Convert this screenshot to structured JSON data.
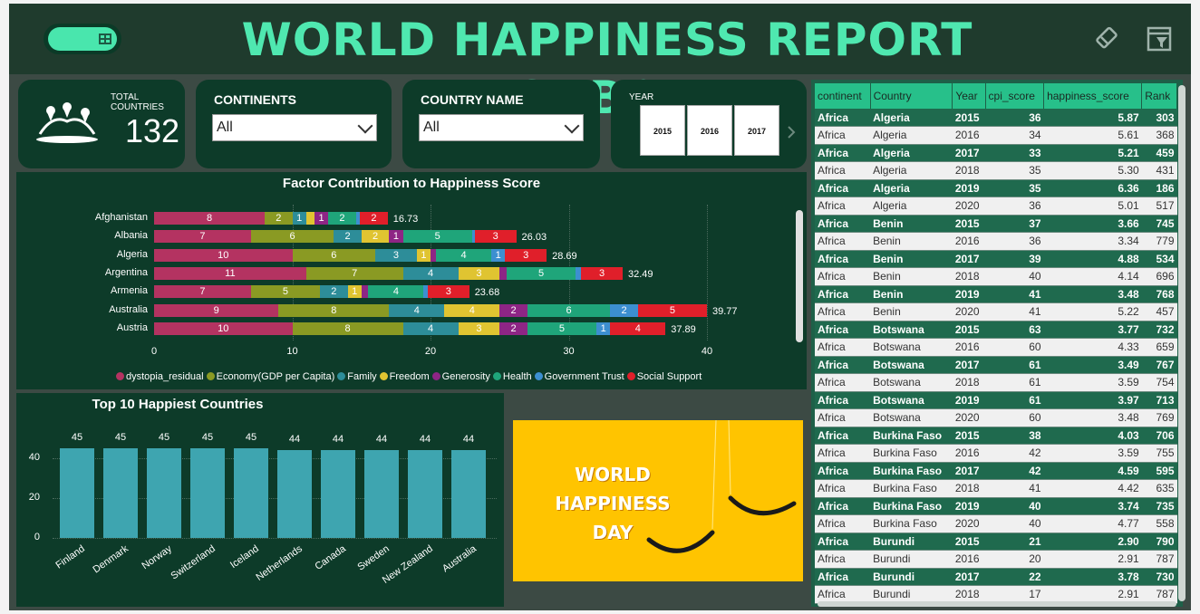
{
  "header": {
    "title": "WORLD HAPPINESS REPORT DASHBOARD",
    "icons": [
      "grid-icon",
      "eraser-icon",
      "filter-icon"
    ]
  },
  "kpi": {
    "label": "TOTAL COUNTRIES",
    "value": "132"
  },
  "filters": {
    "continents": {
      "label": "CONTINENTS",
      "value": "All"
    },
    "country": {
      "label": "COUNTRY NAME",
      "value": "All"
    },
    "year": {
      "label": "YEAR",
      "options": [
        "2015",
        "2016",
        "2017"
      ]
    }
  },
  "factor_chart": {
    "title": "Factor Contribution to Happiness Score",
    "ticks": [
      "0",
      "10",
      "20",
      "30",
      "40"
    ],
    "legend": [
      "dystopia_residual",
      "Economy(GDP per Capita)",
      "Family",
      "Freedom",
      "Generosity",
      "Health",
      "Government Trust",
      "Social Support"
    ],
    "colors": [
      "#b43361",
      "#8a9a23",
      "#2d8d99",
      "#e0c431",
      "#8e2585",
      "#1fa57a",
      "#3c8fd0",
      "#e01f2a"
    ]
  },
  "top10": {
    "title": "Top 10 Happiest Countries",
    "yticks": [
      "0",
      "20",
      "40"
    ]
  },
  "banner": {
    "line1": "WORLD",
    "line2": "HAPPINESS",
    "line3": "DAY"
  },
  "table": {
    "headers": [
      "continent",
      "Country",
      "Year",
      "cpi_score",
      "happiness_score",
      "Rank"
    ],
    "rows": [
      [
        "Africa",
        "Algeria",
        "2015",
        "36",
        "5.87",
        "303"
      ],
      [
        "Africa",
        "Algeria",
        "2016",
        "34",
        "5.61",
        "368"
      ],
      [
        "Africa",
        "Algeria",
        "2017",
        "33",
        "5.21",
        "459"
      ],
      [
        "Africa",
        "Algeria",
        "2018",
        "35",
        "5.30",
        "431"
      ],
      [
        "Africa",
        "Algeria",
        "2019",
        "35",
        "6.36",
        "186"
      ],
      [
        "Africa",
        "Algeria",
        "2020",
        "36",
        "5.01",
        "517"
      ],
      [
        "Africa",
        "Benin",
        "2015",
        "37",
        "3.66",
        "745"
      ],
      [
        "Africa",
        "Benin",
        "2016",
        "36",
        "3.34",
        "779"
      ],
      [
        "Africa",
        "Benin",
        "2017",
        "39",
        "4.88",
        "534"
      ],
      [
        "Africa",
        "Benin",
        "2018",
        "40",
        "4.14",
        "696"
      ],
      [
        "Africa",
        "Benin",
        "2019",
        "41",
        "3.48",
        "768"
      ],
      [
        "Africa",
        "Benin",
        "2020",
        "41",
        "5.22",
        "457"
      ],
      [
        "Africa",
        "Botswana",
        "2015",
        "63",
        "3.77",
        "732"
      ],
      [
        "Africa",
        "Botswana",
        "2016",
        "60",
        "4.33",
        "659"
      ],
      [
        "Africa",
        "Botswana",
        "2017",
        "61",
        "3.49",
        "767"
      ],
      [
        "Africa",
        "Botswana",
        "2018",
        "61",
        "3.59",
        "754"
      ],
      [
        "Africa",
        "Botswana",
        "2019",
        "61",
        "3.97",
        "713"
      ],
      [
        "Africa",
        "Botswana",
        "2020",
        "60",
        "3.48",
        "769"
      ],
      [
        "Africa",
        "Burkina Faso",
        "2015",
        "38",
        "4.03",
        "706"
      ],
      [
        "Africa",
        "Burkina Faso",
        "2016",
        "42",
        "3.59",
        "755"
      ],
      [
        "Africa",
        "Burkina Faso",
        "2017",
        "42",
        "4.59",
        "595"
      ],
      [
        "Africa",
        "Burkina Faso",
        "2018",
        "41",
        "4.42",
        "635"
      ],
      [
        "Africa",
        "Burkina Faso",
        "2019",
        "40",
        "3.74",
        "735"
      ],
      [
        "Africa",
        "Burkina Faso",
        "2020",
        "40",
        "4.77",
        "558"
      ],
      [
        "Africa",
        "Burundi",
        "2015",
        "21",
        "2.90",
        "790"
      ],
      [
        "Africa",
        "Burundi",
        "2016",
        "20",
        "2.91",
        "787"
      ],
      [
        "Africa",
        "Burundi",
        "2017",
        "22",
        "3.78",
        "730"
      ],
      [
        "Africa",
        "Burundi",
        "2018",
        "17",
        "2.91",
        "787"
      ]
    ]
  },
  "chart_data": [
    {
      "type": "bar",
      "orientation": "horizontal-stacked",
      "title": "Factor Contribution to Happiness Score",
      "categories": [
        "Afghanistan",
        "Albania",
        "Algeria",
        "Argentina",
        "Armenia",
        "Australia",
        "Austria"
      ],
      "xlim": [
        0,
        40
      ],
      "legend_position": "bottom",
      "series": [
        {
          "name": "dystopia_residual",
          "values": [
            8,
            7,
            10,
            11,
            7,
            9,
            10
          ]
        },
        {
          "name": "Economy(GDP per Capita)",
          "values": [
            2,
            6,
            6,
            7,
            5,
            8,
            8
          ]
        },
        {
          "name": "Family",
          "values": [
            1,
            2,
            3,
            4,
            2,
            4,
            4
          ]
        },
        {
          "name": "Freedom",
          "values": [
            0.6,
            2,
            1,
            3,
            1,
            4,
            3
          ]
        },
        {
          "name": "Generosity",
          "values": [
            1,
            1,
            0.4,
            0.5,
            0.5,
            2,
            2
          ]
        },
        {
          "name": "Health",
          "values": [
            2,
            5,
            4,
            5,
            4,
            6,
            5
          ]
        },
        {
          "name": "Government Trust",
          "values": [
            0.3,
            0.2,
            1,
            0.4,
            0.3,
            2,
            1
          ]
        },
        {
          "name": "Social Support",
          "values": [
            2,
            3,
            3,
            3,
            3,
            5,
            4
          ]
        }
      ],
      "totals": [
        "16.73",
        "26.03",
        "28.69",
        "32.49",
        "23.68",
        "39.77",
        "37.89"
      ]
    },
    {
      "type": "bar",
      "title": "Top 10 Happiest Countries",
      "categories": [
        "Finland",
        "Denmark",
        "Norway",
        "Switzerland",
        "Iceland",
        "Netherlands",
        "Canada",
        "Sweden",
        "New Zealand",
        "Australia"
      ],
      "values": [
        45,
        45,
        45,
        45,
        45,
        44,
        44,
        44,
        44,
        44
      ],
      "ylim": [
        0,
        50
      ],
      "color": "#3ea5b0"
    }
  ]
}
